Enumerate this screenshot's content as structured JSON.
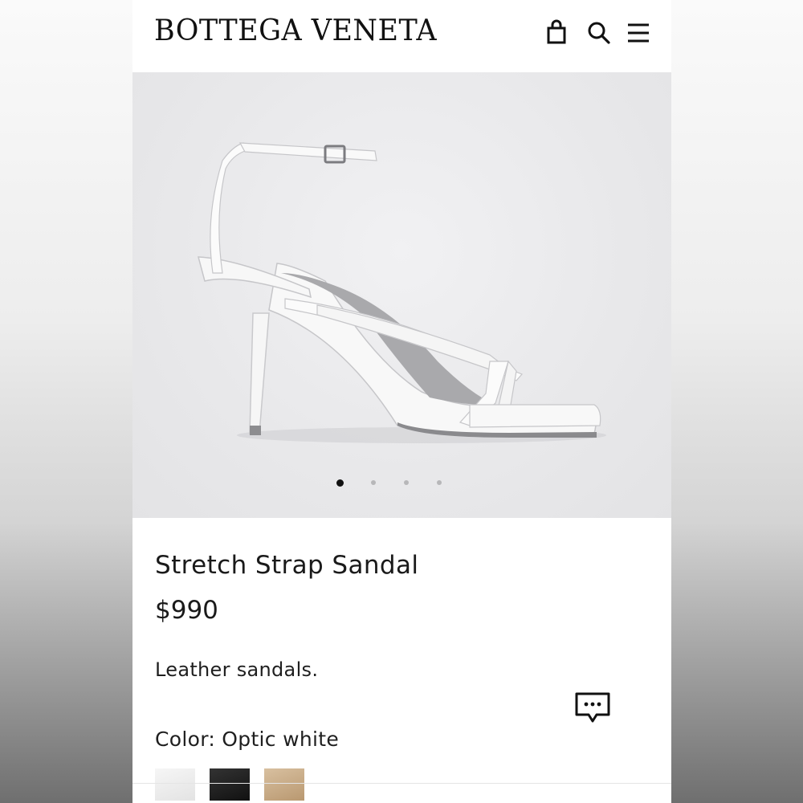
{
  "header": {
    "brand": "BOTTEGA VENETA",
    "icons": [
      "shopping-bag-icon",
      "search-icon",
      "menu-icon"
    ]
  },
  "gallery": {
    "image": "white stretch strap sandal",
    "dots_total": 4,
    "dots_active_index": 0
  },
  "product": {
    "name": "Stretch Strap Sandal",
    "price": "$990",
    "description": "Leather sandals.",
    "color_label": "Color: Optic white",
    "swatches": [
      "#efefef",
      "#1a1a1a",
      "#c9ad88"
    ]
  },
  "chat_icon": "chat-icon"
}
